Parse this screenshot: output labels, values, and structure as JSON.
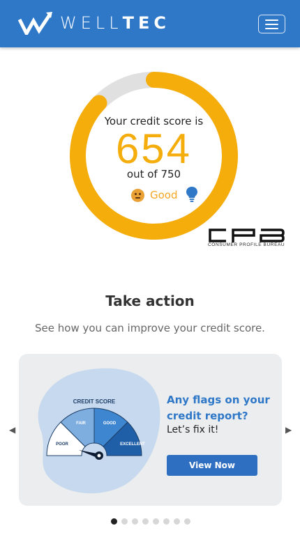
{
  "header": {
    "logo_light": "WELL",
    "logo_bold": "TEC",
    "menu_icon": "hamburger-icon"
  },
  "score": {
    "intro": "Your credit score is",
    "value": "654",
    "value_num": 654,
    "max_text": "out of 750",
    "max_num": 750,
    "rating": "Good",
    "rating_icon": "neutral-face-icon",
    "tip_icon": "lightbulb-icon",
    "colors": {
      "arc": "#f5ad0c",
      "track": "#e0e0e0"
    }
  },
  "bureau": {
    "logo_letters": "CPB",
    "name": "CONSUMER PROFILE BUREAU"
  },
  "action": {
    "title": "Take action",
    "subtitle": "See how you can improve your credit score."
  },
  "carousel": {
    "prev_icon": "chevron-left-icon",
    "next_icon": "chevron-right-icon",
    "card": {
      "gauge_title": "CREDIT SCORE",
      "segments": [
        "POOR",
        "FAIR",
        "GOOD",
        "EXCELLENT"
      ],
      "heading": "Any flags on your credit report?",
      "text": "Let’s fix it!",
      "button": "View Now"
    },
    "slide_count": 8,
    "active_index": 0
  },
  "brand_colors": {
    "primary": "#2f78c8",
    "accent": "#f5ad0c"
  }
}
